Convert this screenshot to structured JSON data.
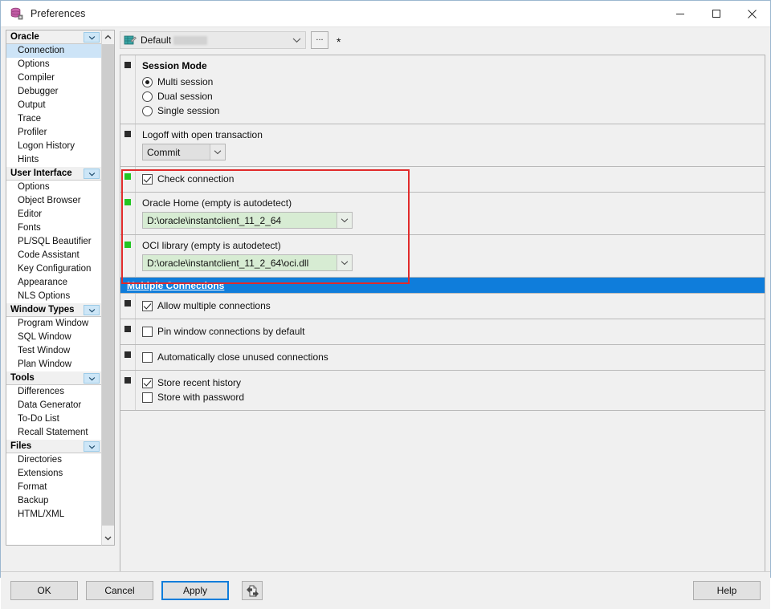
{
  "window": {
    "title": "Preferences",
    "icon": "database-preferences-icon",
    "controls": {
      "minimize": "minimize-icon",
      "maximize": "maximize-icon",
      "close": "close-icon"
    }
  },
  "sidebar": {
    "scroll_up_icon": "chevron-up-icon",
    "scroll_down_icon": "chevron-down-icon",
    "groups": [
      {
        "header": "Oracle",
        "arrow_icon": "chevron-down-icon",
        "items": [
          {
            "label": "Connection",
            "selected": true
          },
          {
            "label": "Options",
            "selected": false
          },
          {
            "label": "Compiler",
            "selected": false
          },
          {
            "label": "Debugger",
            "selected": false
          },
          {
            "label": "Output",
            "selected": false
          },
          {
            "label": "Trace",
            "selected": false
          },
          {
            "label": "Profiler",
            "selected": false
          },
          {
            "label": "Logon History",
            "selected": false
          },
          {
            "label": "Hints",
            "selected": false
          }
        ]
      },
      {
        "header": "User Interface",
        "arrow_icon": "chevron-down-icon",
        "items": [
          {
            "label": "Options",
            "selected": false
          },
          {
            "label": "Object Browser",
            "selected": false
          },
          {
            "label": "Editor",
            "selected": false
          },
          {
            "label": "Fonts",
            "selected": false
          },
          {
            "label": "PL/SQL Beautifier",
            "selected": false
          },
          {
            "label": "Code Assistant",
            "selected": false
          },
          {
            "label": "Key Configuration",
            "selected": false
          },
          {
            "label": "Appearance",
            "selected": false
          },
          {
            "label": "NLS Options",
            "selected": false
          }
        ]
      },
      {
        "header": "Window Types",
        "arrow_icon": "chevron-down-icon",
        "items": [
          {
            "label": "Program Window",
            "selected": false
          },
          {
            "label": "SQL Window",
            "selected": false
          },
          {
            "label": "Test Window",
            "selected": false
          },
          {
            "label": "Plan Window",
            "selected": false
          }
        ]
      },
      {
        "header": "Tools",
        "arrow_icon": "chevron-down-icon",
        "items": [
          {
            "label": "Differences",
            "selected": false
          },
          {
            "label": "Data Generator",
            "selected": false
          },
          {
            "label": "To-Do List",
            "selected": false
          },
          {
            "label": "Recall Statement",
            "selected": false
          }
        ]
      },
      {
        "header": "Files",
        "arrow_icon": "chevron-down-icon",
        "items": [
          {
            "label": "Directories",
            "selected": false
          },
          {
            "label": "Extensions",
            "selected": false
          },
          {
            "label": "Format",
            "selected": false
          },
          {
            "label": "Backup",
            "selected": false
          },
          {
            "label": "HTML/XML",
            "selected": false
          }
        ]
      }
    ]
  },
  "profile_bar": {
    "icon": "preference-set-icon",
    "value": "Default",
    "value_redacted": true,
    "dropdown_icon": "chevron-down-icon",
    "ellipsis_label": "...",
    "modified_marker": "*"
  },
  "main": {
    "rows": [
      {
        "id": "session-mode",
        "marker": "dark",
        "title": "Session Mode",
        "radios": [
          {
            "label": "Multi session",
            "checked": true
          },
          {
            "label": "Dual session",
            "checked": false
          },
          {
            "label": "Single session",
            "checked": false
          }
        ]
      },
      {
        "id": "logoff-transaction",
        "marker": "dark",
        "label": "Logoff with open transaction",
        "combo_value": "Commit",
        "combo_icon": "chevron-down-icon"
      },
      {
        "id": "check-connection",
        "marker": "green",
        "checkbox": {
          "label": "Check connection",
          "checked": true
        }
      },
      {
        "id": "oracle-home",
        "marker": "green",
        "label": "Oracle Home (empty is autodetect)",
        "combo_value": "D:\\oracle\\instantclient_11_2_64",
        "combo_icon": "chevron-down-icon"
      },
      {
        "id": "oci-library",
        "marker": "green",
        "label": "OCI library (empty is autodetect)",
        "combo_value": "D:\\oracle\\instantclient_11_2_64\\oci.dll",
        "combo_icon": "chevron-down-icon"
      }
    ],
    "selected_section": {
      "id": "multiple-connections",
      "label": "Multiple Connections",
      "highlight_color": "#0f7ddb"
    },
    "rows_after": [
      {
        "id": "allow-multiple-connections",
        "marker": "dark",
        "checkbox": {
          "label": "Allow multiple connections",
          "checked": true
        }
      },
      {
        "id": "pin-window-connections",
        "marker": "dark",
        "checkbox": {
          "label": "Pin window connections by default",
          "checked": false
        }
      },
      {
        "id": "auto-close-unused",
        "marker": "dark",
        "checkbox": {
          "label": "Automatically close unused connections",
          "checked": false
        }
      },
      {
        "id": "store-recent-history",
        "marker": "dark",
        "checkboxes": [
          {
            "label": "Store recent history",
            "checked": true
          },
          {
            "label": "Store with password",
            "checked": false
          }
        ]
      }
    ]
  },
  "annotation": {
    "color": "#e12b2b",
    "shape": "rectangle"
  },
  "footer": {
    "ok": "OK",
    "cancel": "Cancel",
    "apply": "Apply",
    "import_export_icon": "import-export-icon",
    "help": "Help"
  }
}
